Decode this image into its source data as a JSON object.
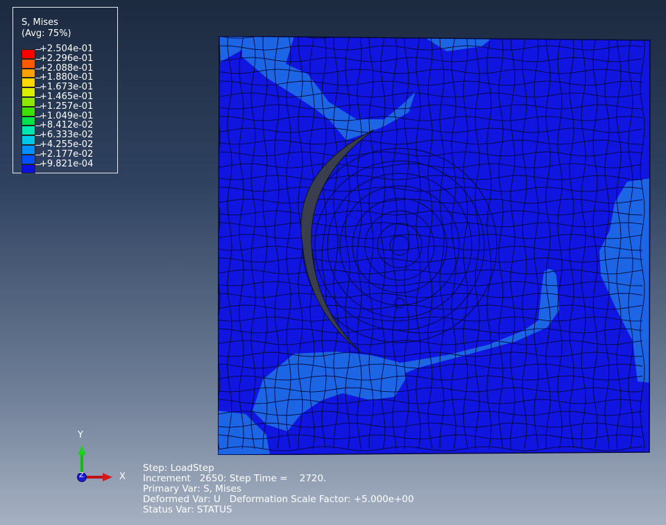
{
  "legend": {
    "title_line1": "S, Mises",
    "title_line2": "(Avg: 75%)",
    "entries": [
      {
        "value": "+2.504e-01",
        "color": "#ff0000"
      },
      {
        "value": "+2.296e-01",
        "color": "#ff5a00"
      },
      {
        "value": "+2.088e-01",
        "color": "#ffa000"
      },
      {
        "value": "+1.880e-01",
        "color": "#ffd700"
      },
      {
        "value": "+1.673e-01",
        "color": "#d8f000"
      },
      {
        "value": "+1.465e-01",
        "color": "#8ce800"
      },
      {
        "value": "+1.257e-01",
        "color": "#3ee000"
      },
      {
        "value": "+1.049e-01",
        "color": "#00e24a"
      },
      {
        "value": "+8.412e-02",
        "color": "#00e6b0"
      },
      {
        "value": "+6.333e-02",
        "color": "#00c8e8"
      },
      {
        "value": "+4.255e-02",
        "color": "#0090ff"
      },
      {
        "value": "+2.177e-02",
        "color": "#0050ff"
      },
      {
        "value": "+9.821e-04",
        "color": "#0a10e0"
      }
    ]
  },
  "colors": {
    "mesh_base": "#1015e0",
    "mesh_light": "#1c66e6",
    "mesh_lines": "#050838",
    "gap": "#3a3f4e"
  },
  "triad": {
    "y_label": "Y",
    "z_label": "Z",
    "x_label": "X"
  },
  "status": {
    "step": "Step: LoadStep",
    "increment": "Increment   2650: Step Time =    2720.",
    "primary_var": "Primary Var: S, Mises",
    "deformed_var": "Deformed Var: U   Deformation Scale Factor: +5.000e+00",
    "status_var": "Status Var: STATUS"
  }
}
